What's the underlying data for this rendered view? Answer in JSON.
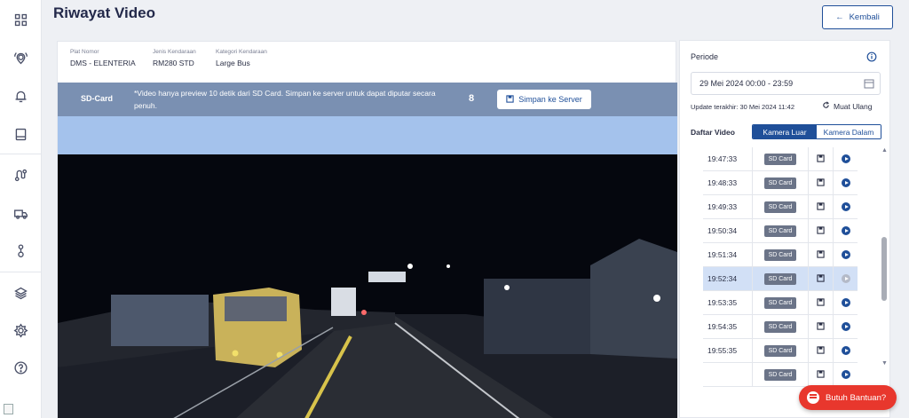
{
  "page": {
    "title": "Riwayat Video",
    "back_label": "Kembali"
  },
  "vehicle": {
    "plate_label": "Plat Nomor",
    "plate_value": "DMS - ELENTERIA",
    "type_label": "Jenis Kendaraan",
    "type_value": "RM280 STD",
    "category_label": "Kategori Kendaraan",
    "category_value": "Large Bus"
  },
  "notice": {
    "source_label": "SD-Card",
    "text": "*Video hanya preview 10 detik dari SD Card. Simpan ke server untuk dapat diputar secara penuh.",
    "count": "8",
    "save_button": "Simpan ke Server"
  },
  "panel": {
    "periode_label": "Periode",
    "date_range": "29 Mei 2024 00:00 - 23:59",
    "update_text": "Update terakhir: 30 Mei 2024 11:42",
    "reload_label": "Muat Ulang",
    "list_title": "Daftar Video",
    "tabs": [
      {
        "label": "Kamera Luar"
      },
      {
        "label": "Kamera Dalam"
      }
    ],
    "videos": [
      {
        "time": "19:47:33",
        "source": "SD Card"
      },
      {
        "time": "19:48:33",
        "source": "SD Card"
      },
      {
        "time": "19:49:33",
        "source": "SD Card"
      },
      {
        "time": "19:50:34",
        "source": "SD Card"
      },
      {
        "time": "19:51:34",
        "source": "SD Card"
      },
      {
        "time": "19:52:34",
        "source": "SD Card"
      },
      {
        "time": "19:53:35",
        "source": "SD Card"
      },
      {
        "time": "19:54:35",
        "source": "SD Card"
      },
      {
        "time": "19:55:35",
        "source": "SD Card"
      },
      {
        "time": "",
        "source": "SD Card"
      }
    ]
  },
  "help": {
    "label": "Butuh Bantuan?"
  },
  "colors": {
    "accent": "#1f4f99",
    "notice_bg": "#7a90b2",
    "notice_light": "#a4c2ec",
    "help": "#e8372d",
    "selected_row": "#d2e0f6"
  }
}
